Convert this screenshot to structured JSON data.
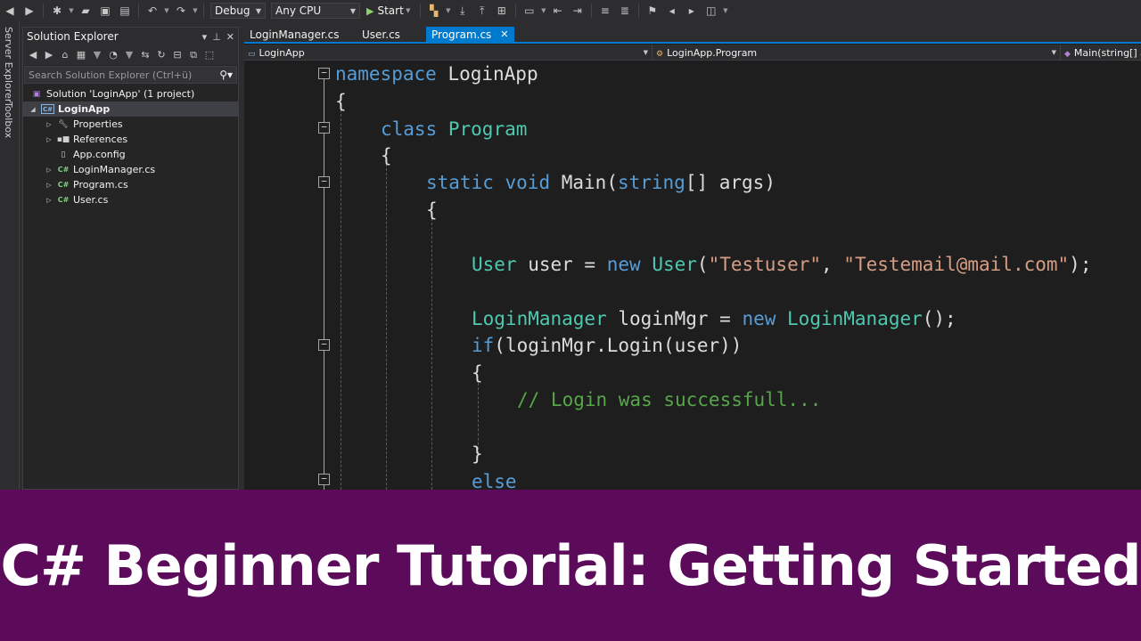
{
  "toolbar": {
    "config": "Debug",
    "platform": "Any CPU",
    "start_label": "Start"
  },
  "side_strip": {
    "server_explorer": "Server Explorer",
    "toolbox": "Toolbox"
  },
  "solution_explorer": {
    "title": "Solution Explorer",
    "search_placeholder": "Search Solution Explorer (Ctrl+ü)",
    "items": [
      {
        "label": "Solution 'LoginApp' (1 project)",
        "icon": "solution-icon"
      },
      {
        "label": "LoginApp",
        "icon": "csharp-project-icon",
        "selected": true
      },
      {
        "label": "Properties",
        "icon": "wrench-icon"
      },
      {
        "label": "References",
        "icon": "references-icon"
      },
      {
        "label": "App.config",
        "icon": "config-file-icon"
      },
      {
        "label": "LoginManager.cs",
        "icon": "csharp-file-icon"
      },
      {
        "label": "Program.cs",
        "icon": "csharp-file-icon"
      },
      {
        "label": "User.cs",
        "icon": "csharp-file-icon"
      }
    ]
  },
  "editor": {
    "tabs": [
      {
        "label": "LoginManager.cs",
        "active": false
      },
      {
        "label": "User.cs",
        "active": false
      },
      {
        "label": "Program.cs",
        "active": true
      }
    ],
    "nav": {
      "project": "LoginApp",
      "type": "LoginApp.Program",
      "member": "Main(string[] args)"
    },
    "code": {
      "l1_kw": "namespace",
      "l1_name": " LoginApp",
      "l2": "{",
      "l3_kw": "class",
      "l3_name": "Program",
      "l4": "{",
      "l5_kw1": "static",
      "l5_kw2": "void",
      "l5_name": "Main(",
      "l5_kw3": "string",
      "l5_rest": "[] args)",
      "l6": "{",
      "l8_type1": "User",
      "l8_a": " user = ",
      "l8_kw": "new",
      "l8_type2": "User",
      "l8_b": "(",
      "l8_str1": "\"Testuser\"",
      "l8_c": ", ",
      "l8_str2": "\"Testemail@mail.com\"",
      "l8_d": ");",
      "l10_type1": "LoginManager",
      "l10_a": " loginMgr = ",
      "l10_kw": "new",
      "l10_type2": "LoginManager",
      "l10_b": "();",
      "l11_kw": "if",
      "l11_rest": "(loginMgr.Login(user))",
      "l12": "{",
      "l13_comment": "// Login was successfull...",
      "l15": "}",
      "l16_kw": "else"
    }
  },
  "banner": {
    "text": "C# Beginner Tutorial: Getting Started",
    "color": "#5c0a5a"
  }
}
